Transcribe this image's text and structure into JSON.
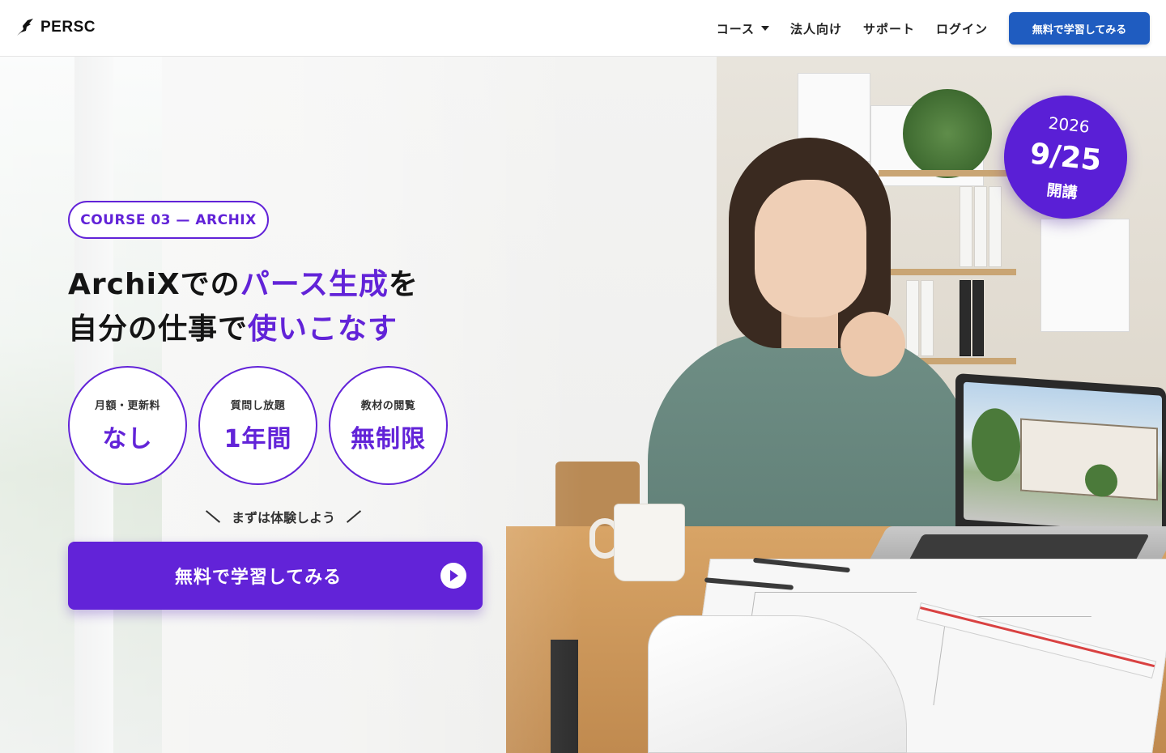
{
  "header": {
    "logo_text": "PERSC",
    "nav": [
      {
        "label": "コース",
        "has_dropdown": true
      },
      {
        "label": "法人向け"
      },
      {
        "label": "サポート"
      },
      {
        "label": "ログイン"
      }
    ],
    "cta_label": "無料で学習してみる",
    "cta_color": "#1f5cc0"
  },
  "hero": {
    "course_tag": "COURSE 03 — ARCHIX",
    "headline": {
      "line1": [
        {
          "text": "ArchiXでの",
          "highlight": false
        },
        {
          "text": "パース生成",
          "highlight": true
        },
        {
          "text": "を",
          "highlight": false
        }
      ],
      "line2": [
        {
          "text": "自分の仕事で",
          "highlight": false
        },
        {
          "text": "使いこなす",
          "highlight": true
        }
      ]
    },
    "features": [
      {
        "label": "月額・更新料",
        "value": "なし"
      },
      {
        "label": "質問し放題",
        "value": "1年間"
      },
      {
        "label": "教材の閲覧",
        "value": "無制限"
      }
    ],
    "trial_text": "まずは体験しよう",
    "cta_label": "無料で学習してみる",
    "accent_color": "#6223d8",
    "date_badge": {
      "year": "2026",
      "date": "9/25",
      "label": "開講"
    }
  },
  "icons": {
    "logo": "bird-logo-icon",
    "nav_dropdown": "caret-down-icon",
    "cta": "play-circle-icon"
  }
}
